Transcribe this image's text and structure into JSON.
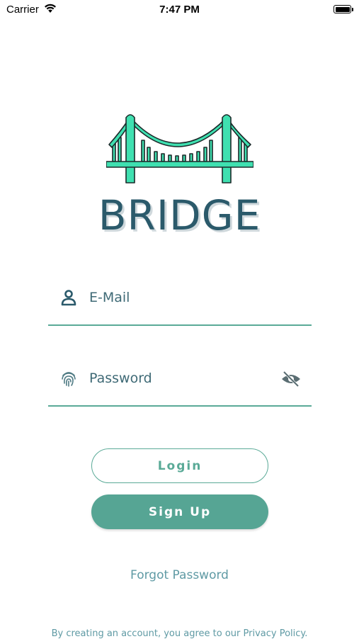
{
  "status_bar": {
    "carrier": "Carrier",
    "time": "7:47 PM",
    "icons": [
      "wifi-icon",
      "battery-icon"
    ]
  },
  "brand": {
    "name": "BRIDGE",
    "logo_icon": "bridge-icon",
    "primary_color": "#3fe0b0",
    "text_color": "#2b5a6b"
  },
  "form": {
    "email": {
      "placeholder": "E-Mail",
      "value": "",
      "icon": "user-icon"
    },
    "password": {
      "placeholder": "Password",
      "value": "",
      "icon": "fingerprint-icon",
      "toggle_icon": "eye-off-icon"
    }
  },
  "actions": {
    "login_label": "Login",
    "signup_label": "Sign Up",
    "forgot_label": "Forgot Password",
    "accent_color": "#56a594"
  },
  "footer": {
    "terms_text": "By creating an account, you agree to our Privacy Policy."
  }
}
